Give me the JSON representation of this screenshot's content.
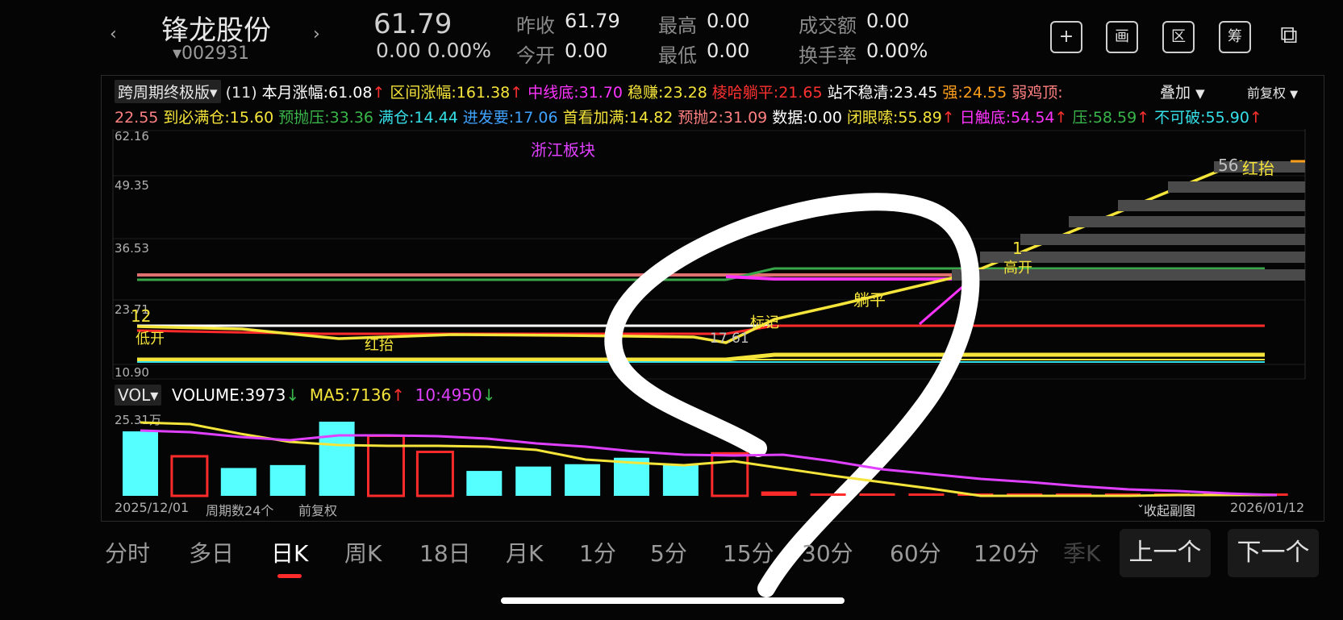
{
  "header": {
    "stock_name": "锋龙股份",
    "stock_code": "002931",
    "price": "61.79",
    "change": "0.00",
    "change_pct": "0.00%",
    "stats": [
      {
        "label": "昨收",
        "value": "61.79"
      },
      {
        "label": "最高",
        "value": "0.00"
      },
      {
        "label": "成交额",
        "value": "0.00"
      },
      {
        "label": "今开",
        "value": "0.00"
      },
      {
        "label": "最低",
        "value": "0.00"
      },
      {
        "label": "换手率",
        "value": "0.00%"
      }
    ],
    "actions": [
      "+",
      "画",
      "区",
      "筹",
      "⧉"
    ]
  },
  "indicator": {
    "name": "跨周期终极版",
    "period": "(11)",
    "overlay": "叠加",
    "adjust": "前复权",
    "row1": [
      {
        "text": "本月涨幅:61.08",
        "color": "#ffffff",
        "arrow": "↑",
        "arrow_color": "#ff3030"
      },
      {
        "text": "区间涨幅:161.38",
        "color": "#f5e43a",
        "arrow": "↑",
        "arrow_color": "#ff3030"
      },
      {
        "text": "中线底:31.70",
        "color": "#ff33ff",
        "arrow": "",
        "arrow_color": ""
      },
      {
        "text": "稳赚:23.28",
        "color": "#f5e43a",
        "arrow": "",
        "arrow_color": ""
      },
      {
        "text": "棱哈躺平:21.65",
        "color": "#ff3030",
        "arrow": "",
        "arrow_color": ""
      },
      {
        "text": "站不稳清:23.45",
        "color": "#ffffff",
        "arrow": "",
        "arrow_color": ""
      },
      {
        "text": "强:24.55",
        "color": "#ff9e1b",
        "arrow": "",
        "arrow_color": ""
      },
      {
        "text": "弱鸡顶:",
        "color": "#ff8080",
        "arrow": "",
        "arrow_color": ""
      }
    ],
    "row2": [
      {
        "text": "22.55",
        "color": "#ff8080",
        "arrow": "",
        "arrow_color": ""
      },
      {
        "text": "到必满仓:15.60",
        "color": "#f5e43a",
        "arrow": "",
        "arrow_color": ""
      },
      {
        "text": "预抛压:33.36",
        "color": "#39b54a",
        "arrow": "",
        "arrow_color": ""
      },
      {
        "text": "满仓:14.44",
        "color": "#35e0e8",
        "arrow": "",
        "arrow_color": ""
      },
      {
        "text": "进发要:17.06",
        "color": "#3fa2ff",
        "arrow": "",
        "arrow_color": ""
      },
      {
        "text": "首看加满:14.82",
        "color": "#f5e43a",
        "arrow": "",
        "arrow_color": ""
      },
      {
        "text": "预抛2:31.09",
        "color": "#ff8080",
        "arrow": "",
        "arrow_color": ""
      },
      {
        "text": "数据:0.00",
        "color": "#ffffff",
        "arrow": "",
        "arrow_color": ""
      },
      {
        "text": "闭眼嗦:55.89",
        "color": "#f5e43a",
        "arrow": "↑",
        "arrow_color": "#ff3030"
      },
      {
        "text": "日触底:54.54",
        "color": "#ff33ff",
        "arrow": "↑",
        "arrow_color": "#ff3030"
      },
      {
        "text": "压:58.59",
        "color": "#39b54a",
        "arrow": "↑",
        "arrow_color": "#ff3030"
      },
      {
        "text": "不可破:55.90",
        "color": "#35e0e8",
        "arrow": "↑",
        "arrow_color": "#ff3030"
      }
    ]
  },
  "price_chart": {
    "y_ticks": [
      "62.16",
      "49.35",
      "36.53",
      "23.71",
      "10.90"
    ],
    "annotations": [
      "浙江板块",
      "12",
      "低开",
      "红抬",
      "1",
      "高开",
      "躺平",
      "标记",
      "56",
      "红抬",
      "17.61"
    ]
  },
  "volume": {
    "selector": "VOL",
    "volume_text": "VOLUME:3973",
    "ma5_text": "MA5:7136",
    "ma10_text": "10:4950",
    "y_top": "25.31万",
    "bars": [
      {
        "v": 22,
        "up": true
      },
      {
        "v": 13.5,
        "up": false
      },
      {
        "v": 9.5,
        "up": true
      },
      {
        "v": 10.5,
        "up": true
      },
      {
        "v": 25.3,
        "up": true
      },
      {
        "v": 20.5,
        "up": false
      },
      {
        "v": 15,
        "up": false
      },
      {
        "v": 8.5,
        "up": true
      },
      {
        "v": 10,
        "up": true
      },
      {
        "v": 10.8,
        "up": true
      },
      {
        "v": 13,
        "up": true
      },
      {
        "v": 10.8,
        "up": true
      },
      {
        "v": 14.5,
        "up": false
      },
      {
        "v": 1.5,
        "up": false
      },
      {
        "v": 0.8,
        "up": false
      },
      {
        "v": 0.8,
        "up": false
      },
      {
        "v": 0.8,
        "up": false
      },
      {
        "v": 0.6,
        "up": false
      },
      {
        "v": 0.6,
        "up": false
      },
      {
        "v": 0.6,
        "up": false
      },
      {
        "v": 0.6,
        "up": false
      },
      {
        "v": 0.6,
        "up": false
      },
      {
        "v": 0.6,
        "up": false
      },
      {
        "v": 0.5,
        "up": false
      }
    ]
  },
  "footer": {
    "start_date": "2025/12/01",
    "period_count": "周期数24个",
    "adjust": "前复权",
    "collapse": "收起副图",
    "end_date": "2026/01/12"
  },
  "timeframes": [
    "分时",
    "多日",
    "日K",
    "周K",
    "18日",
    "月K",
    "1分",
    "5分",
    "15分",
    "30分",
    "60分",
    "120分",
    "季K"
  ],
  "active_timeframe": "日K",
  "nav": {
    "prev": "上一个",
    "next": "下一个"
  },
  "colors": {
    "up": "#ff2a2a",
    "down": "#55ffff",
    "accent_yellow": "#f5e43a",
    "magenta": "#e040ff"
  }
}
